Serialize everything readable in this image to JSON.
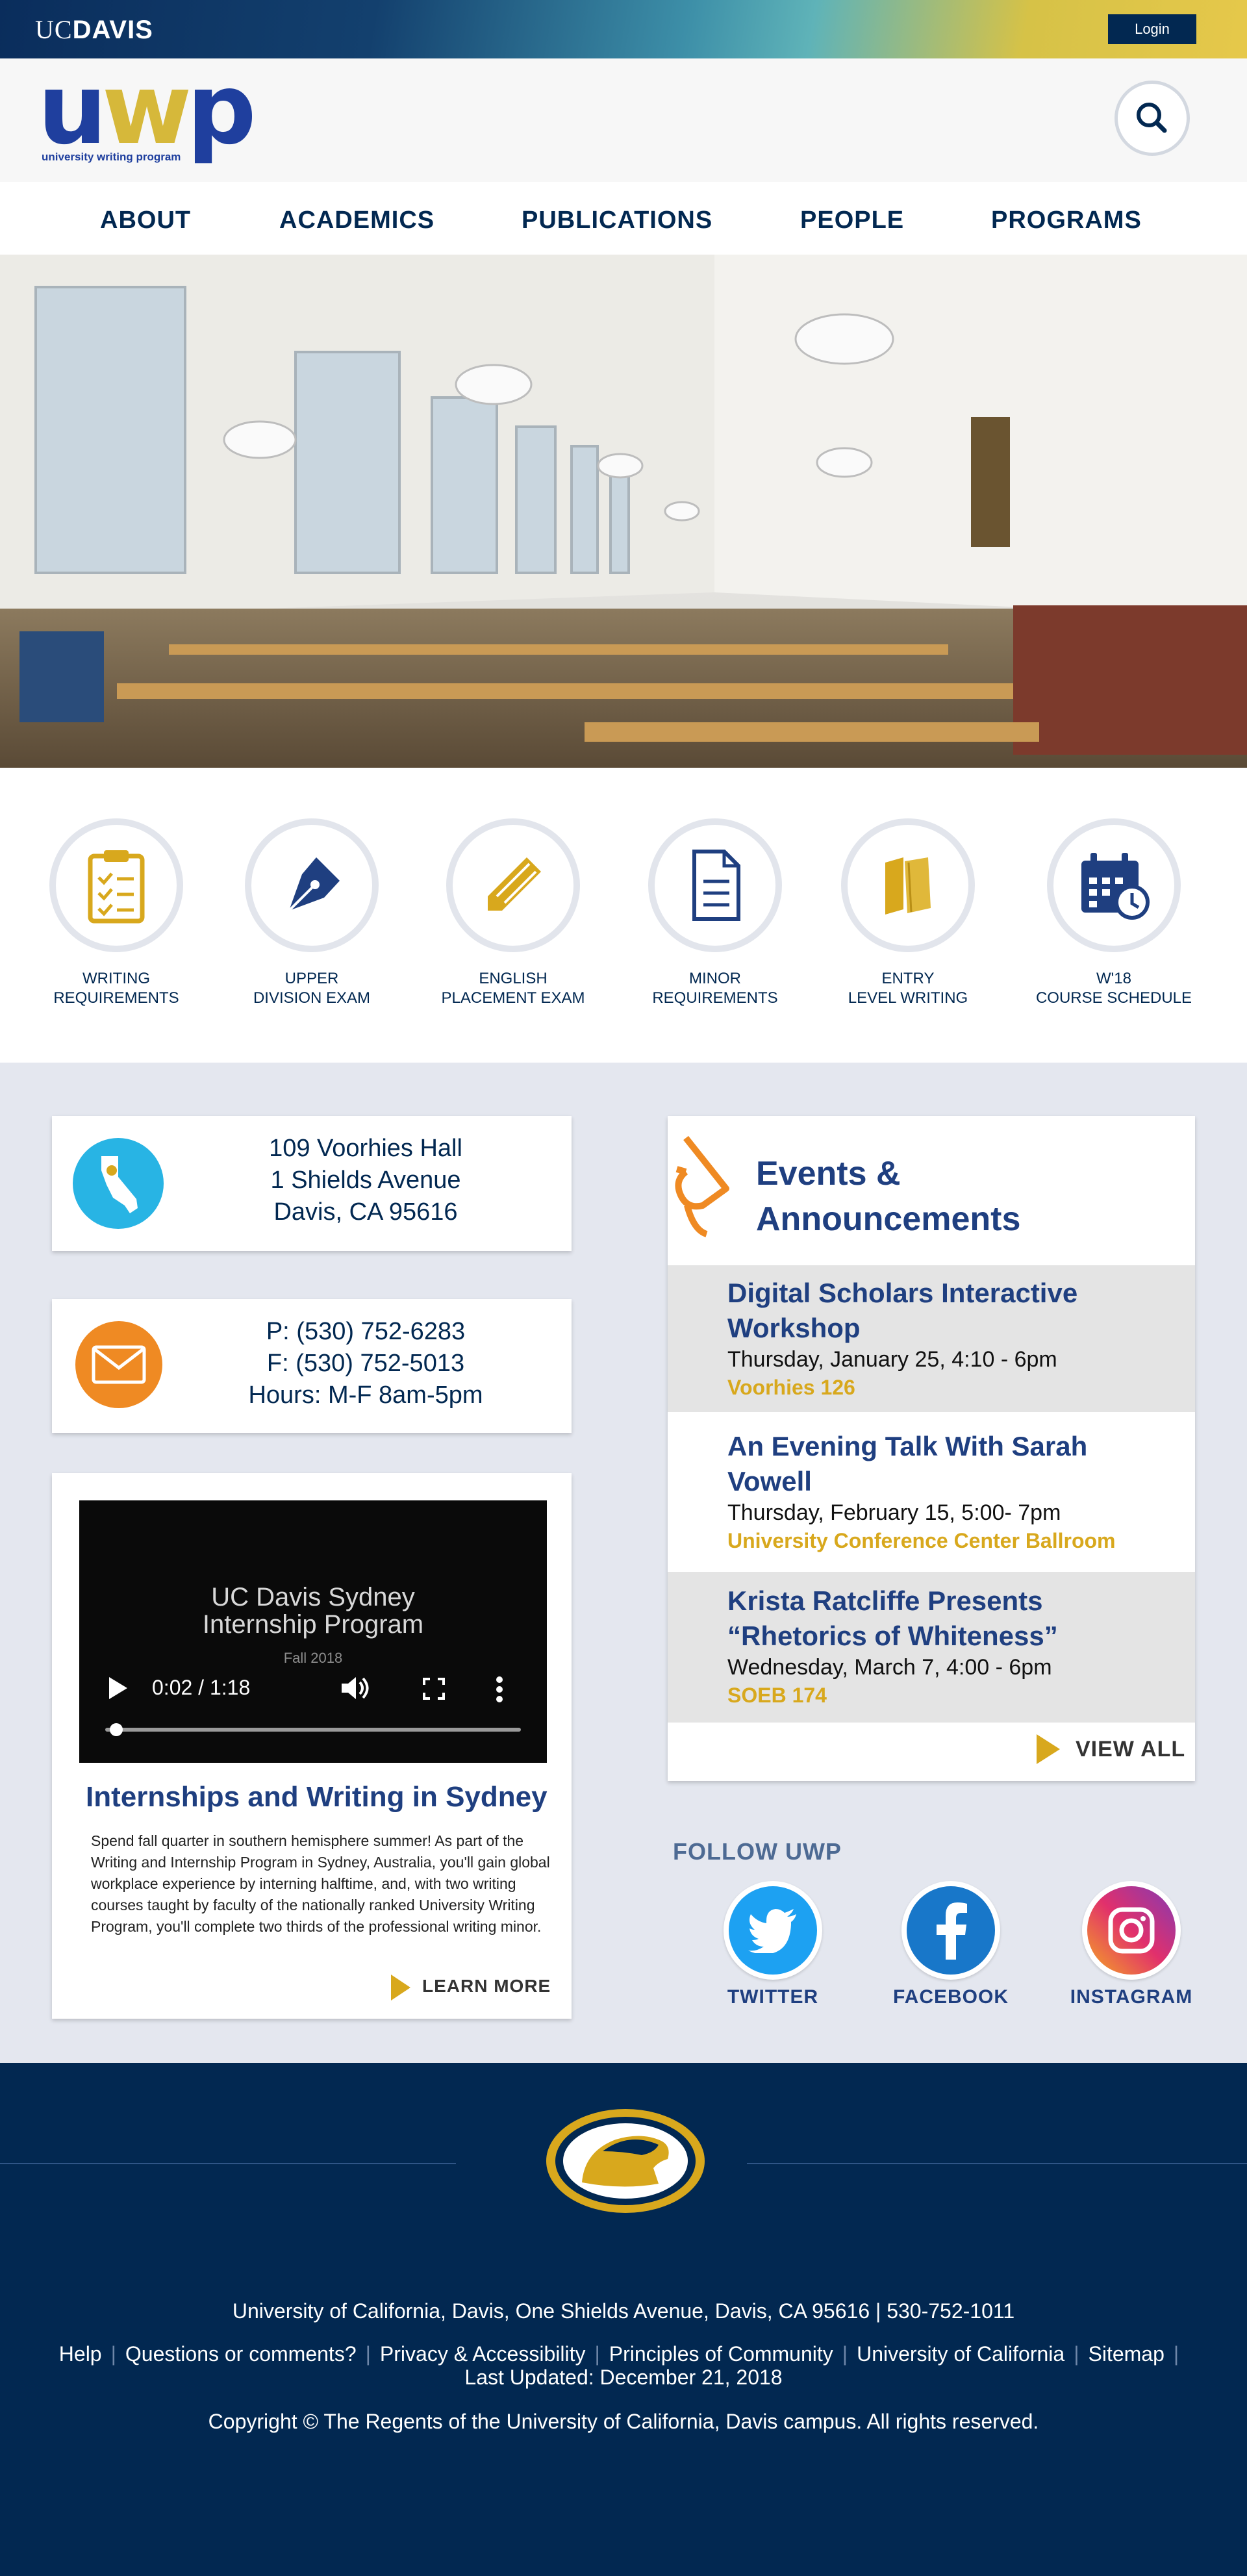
{
  "topbar": {
    "logo_thin": "UC",
    "logo_bold": "DAVIS",
    "login_label": "Login"
  },
  "branding": {
    "logo_u": "u",
    "logo_w": "w",
    "logo_p": "p",
    "logo_subtitle": "university writing program",
    "search_icon": "search-icon"
  },
  "nav": {
    "items": [
      "ABOUT",
      "ACADEMICS",
      "PUBLICATIONS",
      "PEOPLE",
      "PROGRAMS"
    ]
  },
  "quick_links": [
    {
      "label": "WRITING\nREQUIREMENTS",
      "icon": "clipboard-checklist-icon"
    },
    {
      "label": "UPPER\nDIVISION EXAM",
      "icon": "fountain-pen-icon"
    },
    {
      "label": "ENGLISH\nPLACEMENT EXAM",
      "icon": "pencil-icon"
    },
    {
      "label": "MINOR\nREQUIREMENTS",
      "icon": "document-icon"
    },
    {
      "label": "ENTRY\nLEVEL WRITING",
      "icon": "books-icon"
    },
    {
      "label": "W'18\nCOURSE SCHEDULE",
      "icon": "calendar-clock-icon"
    }
  ],
  "contact": {
    "address": {
      "line1": "109 Voorhies Hall",
      "line2": "1 Shields Avenue",
      "line3": "Davis, CA 95616",
      "icon": "california-map-icon"
    },
    "phone": {
      "line1": "P: (530) 752-6283",
      "line2": "F: (530) 752-5013",
      "line3": "Hours: M-F 8am-5pm",
      "icon": "envelope-icon"
    }
  },
  "feature": {
    "video_title": "UC Davis Sydney\nInternship Program",
    "video_subtitle": "Fall 2018",
    "video_time": "0:02 / 1:18",
    "video_progress": 0.026,
    "title": "Internships and Writing in Sydney",
    "body": "Spend fall quarter in southern hemisphere summer! As part of the Writing and Internship Program in Sydney, Australia, you'll gain global workplace experience by interning halftime, and, with two writing courses taught by faculty of the nationally ranked University Writing Program, you'll complete two thirds of the professional writing minor.",
    "cta": "LEARN MORE"
  },
  "events": {
    "heading": "Events &\nAnnouncements",
    "items": [
      {
        "title": "Digital Scholars Interactive Workshop",
        "date": "Thursday, January 25, 4:10 - 6pm",
        "location": "Voorhies 126"
      },
      {
        "title": "An Evening Talk With Sarah Vowell",
        "date": "Thursday, February 15, 5:00- 7pm",
        "location": "University Conference Center Ballroom"
      },
      {
        "title": "Krista Ratcliffe Presents “Rhetorics of Whiteness”",
        "date": "Wednesday, March 7, 4:00 - 6pm",
        "location": "SOEB 174"
      }
    ],
    "view_all": "VIEW ALL"
  },
  "social": {
    "heading": "FOLLOW UWP",
    "items": [
      {
        "label": "TWITTER",
        "icon": "twitter-icon",
        "color": "#1da1f2"
      },
      {
        "label": "FACEBOOK",
        "icon": "facebook-icon",
        "color": "#1877c9"
      },
      {
        "label": "INSTAGRAM",
        "icon": "instagram-icon",
        "color": "#e1306c"
      }
    ]
  },
  "footer": {
    "address": "University of California, Davis, One Shields Avenue, Davis, CA 95616 | 530-752-1011",
    "links": [
      "Help",
      "Questions or comments?",
      "Privacy & Accessibility",
      "Principles of Community",
      "University of California",
      "Sitemap"
    ],
    "updated": "Last Updated: December 21, 2018",
    "copyright": "Copyright © The Regents of the University of California, Davis campus. All rights reserved."
  },
  "colors": {
    "navy": "#022851",
    "gold": "#d8a81d",
    "light_gray": "#e4e7ef",
    "orange": "#ef8a23",
    "cyan": "#28b4e4"
  }
}
